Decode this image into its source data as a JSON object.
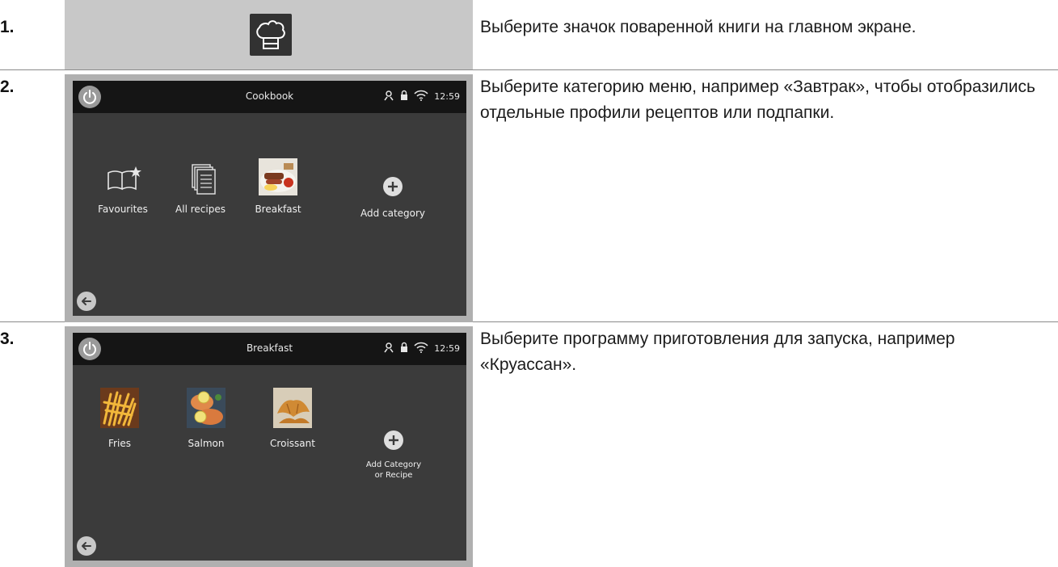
{
  "steps": [
    {
      "number": "1.",
      "text": "Выберите значок поваренной книги на главном экране.",
      "icon": "chef-hat-icon"
    },
    {
      "number": "2.",
      "text": "Выберите категорию меню, например «Завтрак», чтобы отобразились отдельные профили рецептов или подпапки.",
      "screen": {
        "title": "Cookbook",
        "time": "12:59",
        "tiles": [
          {
            "label": "Favourites",
            "icon": "book-star-icon"
          },
          {
            "label": "All recipes",
            "icon": "documents-icon"
          },
          {
            "label": "Breakfast",
            "icon": "breakfast-photo"
          },
          {
            "label": "Add category",
            "icon": "plus-circle-icon"
          }
        ]
      }
    },
    {
      "number": "3.",
      "text": "Выберите программу приготовления для запуска, например «Круассан».",
      "screen": {
        "title": "Breakfast",
        "time": "12:59",
        "tiles": [
          {
            "label": "Fries",
            "icon": "fries-photo"
          },
          {
            "label": "Salmon",
            "icon": "salmon-photo"
          },
          {
            "label": "Croissant",
            "icon": "croissant-photo"
          },
          {
            "label": "Add Category\nor Recipe",
            "icon": "plus-circle-icon"
          }
        ]
      }
    }
  ],
  "colors": {
    "panel_grey": "#c8c8c8",
    "screen_bg": "#3b3b3b",
    "topbar_bg": "#151515",
    "divider": "#8a8a8a"
  }
}
